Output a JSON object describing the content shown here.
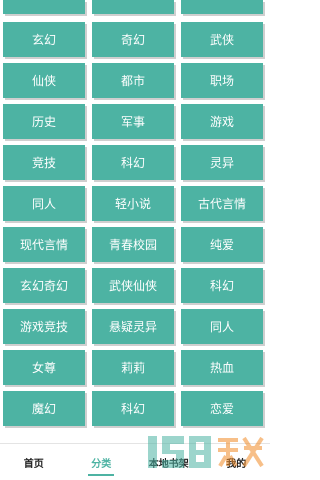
{
  "categories": [
    "玄幻",
    "奇幻",
    "武侠",
    "仙侠",
    "都市",
    "职场",
    "历史",
    "军事",
    "游戏",
    "竞技",
    "科幻",
    "灵异",
    "同人",
    "轻小说",
    "古代言情",
    "现代言情",
    "青春校园",
    "纯爱",
    "玄幻奇幻",
    "武侠仙侠",
    "科幻",
    "游戏竞技",
    "悬疑灵异",
    "同人",
    "女尊",
    "莉莉",
    "热血",
    "魔幻",
    "科幻",
    "恋爱"
  ],
  "nav": {
    "home": "首页",
    "category": "分类",
    "shelf": "本地书架",
    "mine": "我的"
  },
  "active_tab": "category",
  "accent_color": "#4db3a3"
}
